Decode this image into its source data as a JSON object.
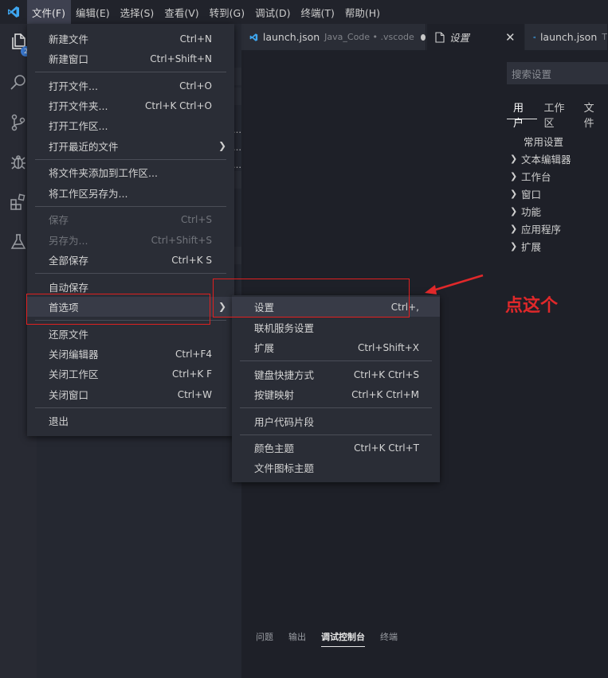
{
  "menubar": {
    "items": [
      "文件(F)",
      "编辑(E)",
      "选择(S)",
      "查看(V)",
      "转到(G)",
      "调试(D)",
      "终端(T)",
      "帮助(H)"
    ]
  },
  "activity": {
    "badge": "2"
  },
  "tabs": [
    {
      "title": "launch.json",
      "desc": "Java_Code • .vscode",
      "dirty": true
    },
    {
      "title": "设置",
      "active": true
    },
    {
      "title": "launch.json",
      "desc": "T"
    }
  ],
  "settings": {
    "search_placeholder": "搜索设置",
    "scope_tabs": [
      "用户",
      "工作区",
      "文件"
    ],
    "tree": [
      "常用设置",
      "文本编辑器",
      "工作台",
      "窗口",
      "功能",
      "应用程序",
      "扩展"
    ]
  },
  "panel": {
    "tabs": [
      "问题",
      "输出",
      "调试控制台",
      "终端"
    ]
  },
  "file_menu": {
    "items": [
      {
        "label": "新建文件",
        "shortcut": "Ctrl+N"
      },
      {
        "label": "新建窗口",
        "shortcut": "Ctrl+Shift+N"
      },
      {
        "label": "打开文件...",
        "shortcut": "Ctrl+O"
      },
      {
        "label": "打开文件夹...",
        "shortcut": "Ctrl+K Ctrl+O"
      },
      {
        "label": "打开工作区...",
        "shortcut": ""
      },
      {
        "label": "打开最近的文件",
        "shortcut": ""
      },
      {
        "label": "将文件夹添加到工作区...",
        "shortcut": ""
      },
      {
        "label": "将工作区另存为...",
        "shortcut": ""
      },
      {
        "label": "保存",
        "shortcut": "Ctrl+S"
      },
      {
        "label": "另存为...",
        "shortcut": "Ctrl+Shift+S"
      },
      {
        "label": "全部保存",
        "shortcut": "Ctrl+K S"
      },
      {
        "label": "自动保存",
        "shortcut": ""
      },
      {
        "label": "首选项",
        "shortcut": ""
      },
      {
        "label": "还原文件",
        "shortcut": ""
      },
      {
        "label": "关闭编辑器",
        "shortcut": "Ctrl+F4"
      },
      {
        "label": "关闭工作区",
        "shortcut": "Ctrl+K F"
      },
      {
        "label": "关闭窗口",
        "shortcut": "Ctrl+W"
      },
      {
        "label": "退出",
        "shortcut": ""
      }
    ]
  },
  "pref_menu": {
    "items": [
      {
        "label": "设置",
        "shortcut": "Ctrl+,"
      },
      {
        "label": "联机服务设置",
        "shortcut": ""
      },
      {
        "label": "扩展",
        "shortcut": "Ctrl+Shift+X"
      },
      {
        "label": "键盘快捷方式",
        "shortcut": "Ctrl+K Ctrl+S"
      },
      {
        "label": "按键映射",
        "shortcut": "Ctrl+K Ctrl+M"
      },
      {
        "label": "用户代码片段",
        "shortcut": ""
      },
      {
        "label": "颜色主题",
        "shortcut": "Ctrl+K Ctrl+T"
      },
      {
        "label": "文件图标主题",
        "shortcut": ""
      }
    ]
  },
  "annotation": {
    "text": "点这个",
    "color": "#e0282a"
  },
  "colors": {
    "accent": "#3b7bd4",
    "vscode_blue": "#3ea6f0"
  }
}
